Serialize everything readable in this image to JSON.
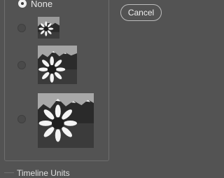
{
  "thumbnail_options": {
    "none_label": "None",
    "selected": "none",
    "sizes": [
      "small",
      "medium",
      "large"
    ]
  },
  "buttons": {
    "cancel_label": "Cancel"
  },
  "next_section": {
    "title": "Timeline Units"
  },
  "colors": {
    "panel_bg": "#535353",
    "text": "#e6e6e6",
    "button_border": "#bdbdbd"
  }
}
